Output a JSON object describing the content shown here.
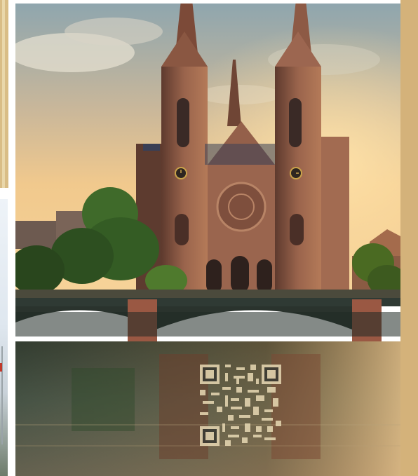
{
  "scene": {
    "subject": "st-paul-church",
    "colors": {
      "frame_gold": "#d4b27a",
      "sky_top": "#8fa6ae",
      "sky_glow": "#f4c57c",
      "stone": "#8d5a45",
      "water": "#2a3a33"
    },
    "icons": [
      "qr-code-icon",
      "clock-icon"
    ]
  }
}
